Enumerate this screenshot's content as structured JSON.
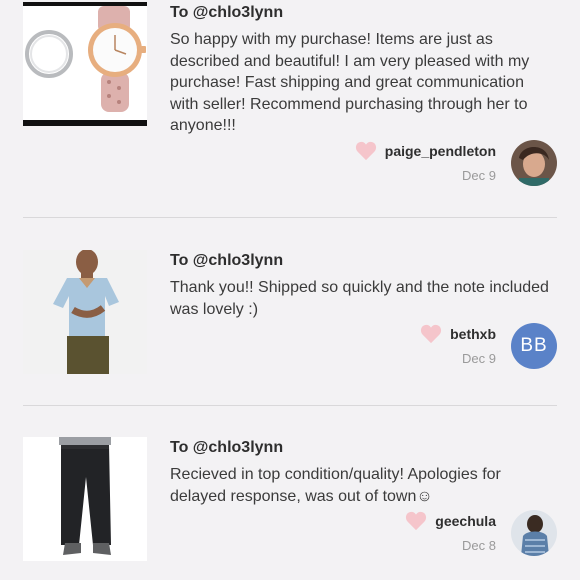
{
  "reviews": [
    {
      "to": "To @chlo3lynn",
      "message": "So happy with my purchase! Items are just as described and beautiful! I am very pleased with my purchase! Fast shipping and great communication with seller! Recommend purchasing through her to anyone!!!",
      "username": "paige_pendleton",
      "date": "Dec 9",
      "thumb_icon": "watch-product-photo",
      "avatar_icon": "user-photo"
    },
    {
      "to": "To @chlo3lynn",
      "message": "Thank you!! Shipped so quickly and the note included was lovely :)",
      "username": "bethxb",
      "date": "Dec 9",
      "avatar_initials": "BB",
      "thumb_icon": "shirt-product-photo"
    },
    {
      "to": "To @chlo3lynn",
      "message": "Recieved in top condition/quality! Apologies for delayed response, was out of town☺",
      "username": "geechula",
      "date": "Dec 8",
      "thumb_icon": "jeans-product-photo",
      "avatar_icon": "user-photo"
    }
  ],
  "colors": {
    "background": "#f3f2f4",
    "heart": "#f5c5cb",
    "avatar_initials_bg": "#5a82c8"
  }
}
